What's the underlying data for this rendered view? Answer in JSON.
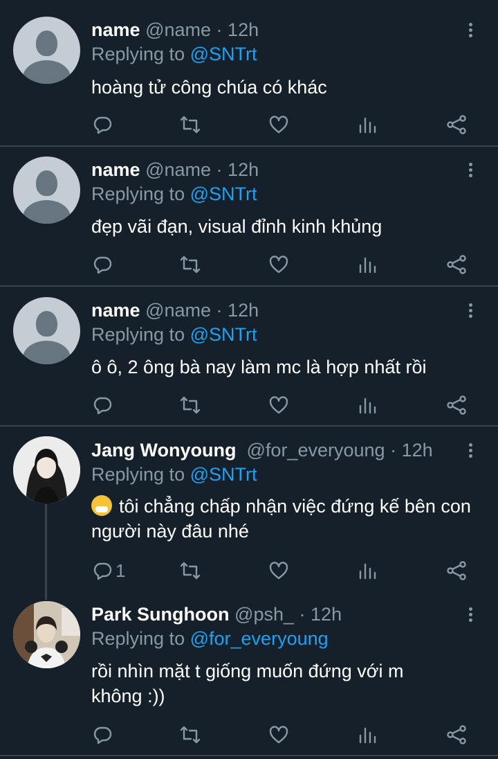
{
  "tweets": [
    {
      "name": "name",
      "handle": "@name",
      "time": "12h",
      "replying_label": "Replying to",
      "replying_to": "@SNTrt",
      "text": "hoàng tử công chúa có khác",
      "reply_count": ""
    },
    {
      "name": "name",
      "handle": "@name",
      "time": "12h",
      "replying_label": "Replying to",
      "replying_to": "@SNTrt",
      "text": "đẹp vãi đạn, visual đỉnh kinh khủng",
      "reply_count": ""
    },
    {
      "name": "name",
      "handle": "@name",
      "time": "12h",
      "replying_label": "Replying to",
      "replying_to": "@SNTrt",
      "text": "ô ô, 2 ông bà nay làm mc là hợp nhất rồi",
      "reply_count": ""
    },
    {
      "name": "Jang Wonyoung",
      "handle": "@for_everyoung",
      "time": "12h",
      "replying_label": "Replying to",
      "replying_to": "@SNTrt",
      "text": "tôi chẳng chấp nhận việc đứng kế bên con người này đâu nhé",
      "emoji": "sneezing-face-emoji",
      "reply_count": "1"
    },
    {
      "name": "Park Sunghoon",
      "handle": "@psh_",
      "time": "12h",
      "replying_label": "Replying to",
      "replying_to": "@for_everyoung",
      "text": "rồi nhìn mặt t giống muốn đứng với m không :))",
      "reply_count": ""
    }
  ],
  "separator": "·",
  "icons": [
    "reply-icon",
    "retweet-icon",
    "like-icon",
    "analytics-icon",
    "share-icon",
    "more-options-icon"
  ],
  "colors": {
    "background": "#15202b",
    "text": "#ffffff",
    "muted": "#8899a6",
    "mention": "#1da1f2",
    "divider": "#38444d"
  }
}
